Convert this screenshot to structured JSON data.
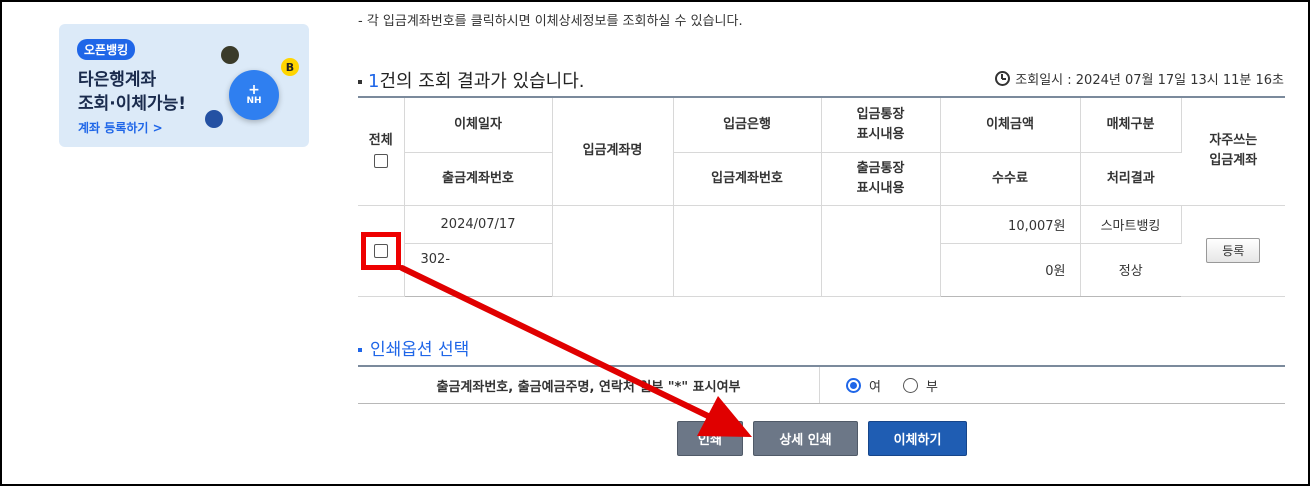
{
  "banner": {
    "tag": "오픈뱅킹",
    "line1": "타은행계좌",
    "line2": "조회·이체가능!",
    "register_link": "계좌 등록하기 >",
    "nh_label": "NH",
    "plus": "+",
    "b_label": "B"
  },
  "notice": "- 각 입금계좌번호를 클릭하시면 이체상세정보를 조회하실 수 있습니다.",
  "result": {
    "count": "1",
    "suffix": "건의 조회 결과가 있습니다.",
    "query_time": "조회일시 : 2024년 07월 17일 13시 11분 16초"
  },
  "table": {
    "headers": {
      "select_all": "전체",
      "transfer_date": "이체일자",
      "withdraw_account": "출금계좌번호",
      "deposit_account_name": "입금계좌명",
      "deposit_bank": "입금은행",
      "deposit_account_no": "입금계좌번호",
      "deposit_memo": "입금통장\n표시내용",
      "withdraw_memo": "출금통장\n표시내용",
      "amount": "이체금액",
      "fee": "수수료",
      "channel": "매체구분",
      "status": "처리결과",
      "favorite": "자주쓰는\n입금계좌"
    },
    "rows": [
      {
        "transfer_date": "2024/07/17",
        "withdraw_account": "302-",
        "deposit_account_name": "",
        "deposit_bank": "",
        "deposit_account_no": "",
        "deposit_memo": "",
        "withdraw_memo": "",
        "amount": "10,007원",
        "fee": "0원",
        "channel": "스마트뱅킹",
        "status": "정상",
        "favorite_button": "등록"
      }
    ]
  },
  "print_options": {
    "title": "인쇄옵션 선택",
    "label": "출금계좌번호, 출금예금주명, 연락처 일부 \"*\" 표시여부",
    "yes": "여",
    "no": "부",
    "selected": "여"
  },
  "buttons": {
    "print": "인쇄",
    "detail_print": "상세 인쇄",
    "transfer": "이체하기"
  },
  "colors": {
    "accent": "#1f66e8",
    "highlight": "#e00000",
    "button_gray": "#6c7787",
    "button_blue": "#1f5db3"
  }
}
